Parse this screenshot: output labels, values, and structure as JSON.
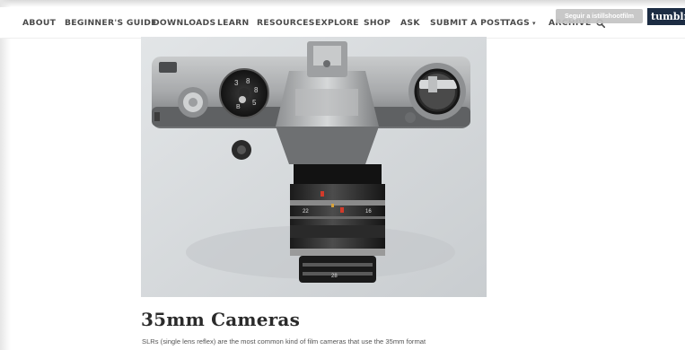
{
  "nav": {
    "items": [
      {
        "label": "ABOUT"
      },
      {
        "label": "BEGINNER'S GUIDE"
      },
      {
        "label": "DOWNLOADS"
      },
      {
        "label": "LEARN"
      },
      {
        "label": "RESOURCES"
      },
      {
        "label": "EXPLORE"
      },
      {
        "label": "SHOP"
      },
      {
        "label": "ASK"
      },
      {
        "label": "SUBMIT A POST"
      },
      {
        "label": "TAGS"
      },
      {
        "label": "ARCHIVE"
      }
    ],
    "tags_caret": "▾",
    "search_icon": "search-icon"
  },
  "tumblr": {
    "follow_label": "Seguir a istillshootfilm",
    "logo_text": "tumblr"
  },
  "post": {
    "title": "35mm Cameras",
    "body": "SLRs (single lens reflex) are the most common kind of film cameras that use the 35mm format"
  },
  "colors": {
    "nav_text": "#4a4a4a",
    "tumblr_brand": "#1c2c43",
    "follow_button": "#c4c4c4"
  }
}
